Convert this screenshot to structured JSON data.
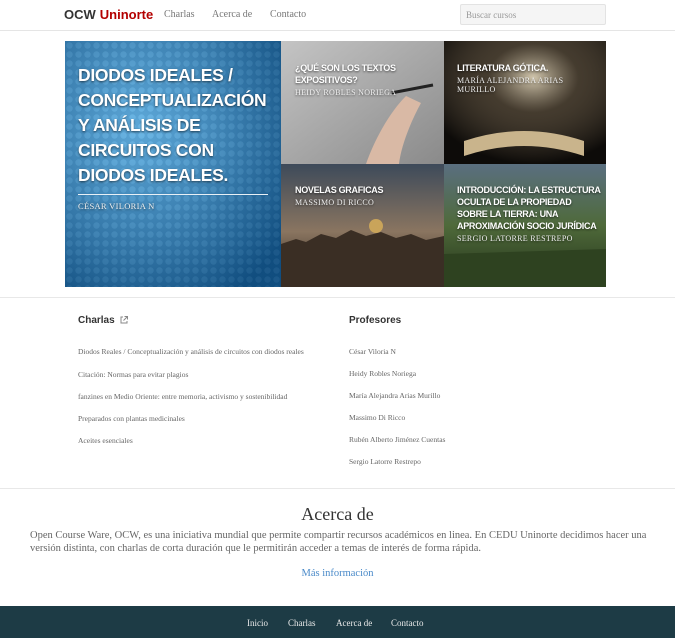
{
  "header": {
    "brand_prefix": "OCW",
    "brand_accent": "Uninorte",
    "nav": [
      "Charlas",
      "Acerca de",
      "Contacto"
    ],
    "search_placeholder": "Buscar cursos"
  },
  "hero": {
    "main": {
      "title": "Diodos Ideales / Conceptualización y análisis de circuitos con diodos ideales.",
      "author": "César Viloria N"
    },
    "tiles": [
      {
        "title": "¿Qué son los textos expositivos?",
        "author": "Heidy Robles Noriega"
      },
      {
        "title": "Literatura gótica.",
        "author": "María Alejandra Arias Murillo"
      },
      {
        "title": "Novelas graficas",
        "author": "Massimo Di Ricco"
      },
      {
        "title": "Introducción: La estructura oculta de la propiedad sobre la tierra: una aproximación socio jurídica",
        "author": "Sergio Latorre Restrepo"
      }
    ]
  },
  "charlas": {
    "heading": "Charlas",
    "items": [
      "Diodos Reales / Conceptualización y análisis de circuitos con diodos reales",
      "Citación: Normas para evitar plagios",
      "fanzines en Medio Oriente: entre memoria, activismo y sostenibilidad",
      "Preparados con plantas medicinales",
      "Aceites esenciales"
    ]
  },
  "profesores": {
    "heading": "Profesores",
    "items": [
      "César Viloria N",
      "Heidy Robles Noriega",
      "María Alejandra Arias Murillo",
      "Massimo Di Ricco",
      "Rubén Alberto Jiménez Cuentas",
      "Sergio Latorre Restrepo"
    ]
  },
  "about": {
    "title": "Acerca de",
    "text": "Open Course Ware, OCW, es una iniciativa mundial que permite compartir recursos académicos en linea. En CEDU Uninorte decidimos hacer una versión distinta, con charlas de corta duración que le permitirán acceder a temas de interés de forma rápida.",
    "link": "Más información"
  },
  "footer": {
    "links": [
      "Inicio",
      "Charlas",
      "Acerca de",
      "Contacto"
    ]
  },
  "colors": {
    "brand_accent": "#b30000",
    "footer_bg": "#1d3b45",
    "link": "#4a8ac9",
    "hero_main": "#1a6fa8"
  }
}
